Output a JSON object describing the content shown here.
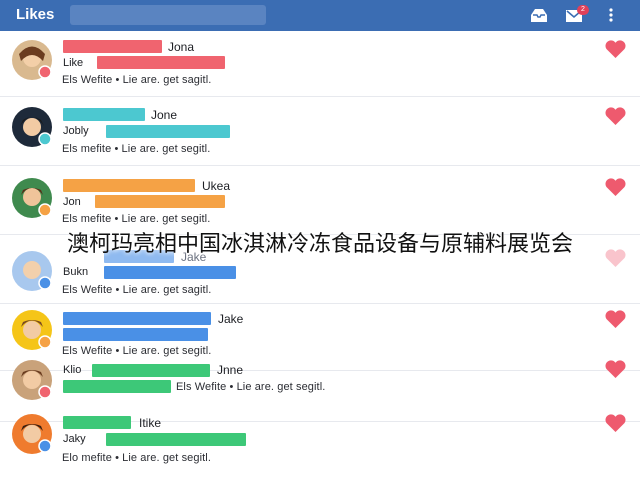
{
  "appbar": {
    "title": "Likes",
    "badge": "2",
    "colors": {
      "bar": "#3b6db3",
      "search": "#5a84c1"
    }
  },
  "items": [
    {
      "name": "Jona",
      "username": "Like",
      "meta": "Els Wefite • Lie are. get sagitl.",
      "colors": [
        "#f0646f",
        "#f0646f"
      ]
    },
    {
      "name": "Jone",
      "username": "Jobly",
      "meta": "Els mefite • Lie are. get segitl.",
      "colors": [
        "#4cc8d0",
        "#4cc8d0"
      ]
    },
    {
      "name": "Ukea",
      "username": "Jon",
      "meta": "Els mefite • Lie are. get segitl.",
      "colors": [
        "#f5a245",
        "#f5a245"
      ]
    },
    {
      "name": "Jake",
      "username": "Bukn",
      "meta": "Els Wefite • Lie are. get sagitl.",
      "colors": [
        "#4a90e6",
        "#4a90e6"
      ]
    },
    {
      "name": "Jake",
      "username": "",
      "meta": "Els Wefite • Lie are. get segitl.",
      "colors": [
        "#4a90e6",
        "#4a90e6"
      ]
    },
    {
      "name": "Jnne",
      "username": "Klio",
      "meta": "Els Wefite • Lie are. get segitl.",
      "colors": [
        "#3dc878",
        "#3dc878"
      ]
    },
    {
      "name": "Itike",
      "username": "Jaky",
      "meta": "Elo mefite • Lie are. get segitl.",
      "colors": [
        "#3dc878",
        "#3dc878"
      ]
    }
  ],
  "overlay": "澳柯玛亮相中国冰淇淋冷冻食品设备与原辅料展览会",
  "heart_color": "#ee5a6e"
}
